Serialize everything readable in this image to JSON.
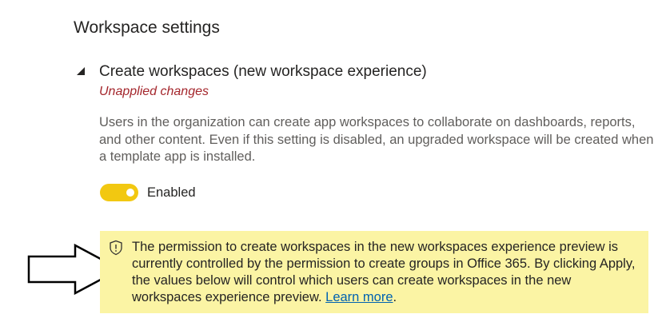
{
  "section": {
    "title": "Workspace settings"
  },
  "setting": {
    "title": "Create workspaces (new workspace experience)",
    "status": "Unapplied changes",
    "description": "Users in the organization can create app workspaces to collaborate on dashboards, reports, and other content. Even if this setting is disabled, an upgraded workspace will be created when a template app is installed.",
    "toggle_label": "Enabled",
    "toggle_on": true
  },
  "notice": {
    "text": "The permission to create workspaces in the new workspaces experience preview is currently controlled by the permission to create groups in Office 365. By clicking Apply, the values below will control which users can create workspaces in the new workspaces experience preview.",
    "link_text": "Learn more",
    "trailing": "."
  },
  "icons": {
    "collapse": "triangle-down-icon",
    "notice": "shield-icon",
    "pointer": "arrow-right-icon"
  },
  "colors": {
    "toggle_on": "#f2c811",
    "notice_bg": "#fbf4a4",
    "unapplied": "#a4262c",
    "link": "#0062b1"
  }
}
